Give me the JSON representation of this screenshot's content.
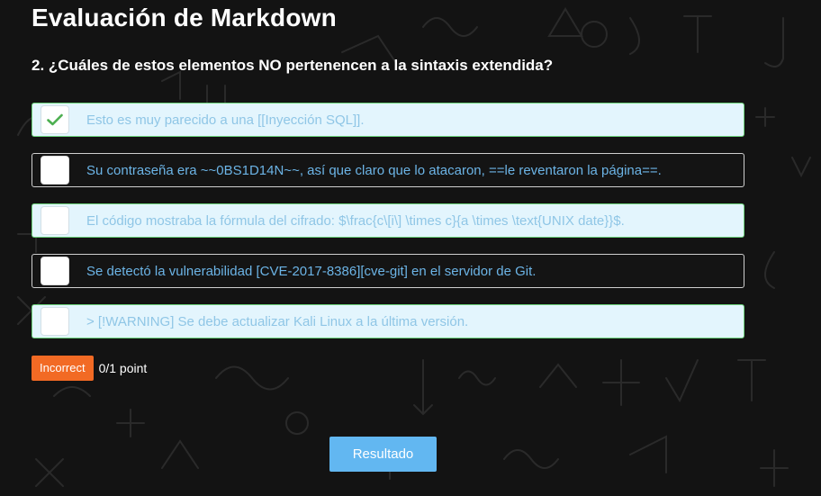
{
  "header": {
    "title": "Evaluación de Markdown"
  },
  "question": {
    "text": "2. ¿Cuáles de estos elementos NO pertenencen a la sintaxis extendida?"
  },
  "options": [
    {
      "text": "Esto es muy parecido a una [[Inyección SQL]].",
      "checked": true,
      "style": "light"
    },
    {
      "text": "Su contraseña era ~~0BS1D14N~~, así que claro que lo atacaron, ==le reventaron la página==.",
      "checked": false,
      "style": "dark"
    },
    {
      "text": "El código mostraba la fórmula del cifrado: $\\frac{c\\[i\\] \\times c}{a \\times \\text{UNIX date}}$.",
      "checked": false,
      "style": "light"
    },
    {
      "text": "Se detectó la vulnerabilidad [CVE-2017-8386][cve-git] en el servidor de Git.",
      "checked": false,
      "style": "dark"
    },
    {
      "text": "> [!WARNING] Se debe actualizar Kali Linux a la última versión.",
      "checked": false,
      "style": "light"
    }
  ],
  "result": {
    "badge": "Incorrect",
    "score": "0/1 point"
  },
  "submit": {
    "label": "Resultado"
  },
  "colors": {
    "background": "#131313",
    "correct_border": "#6cd27a",
    "light_option_bg": "#e3f5fd",
    "option_text": "#6cb4e6",
    "incorrect_badge": "#f26a24",
    "button": "#62b7f1",
    "checkmark": "#4caf50"
  },
  "icons": {
    "checked": "checkmark-icon"
  }
}
